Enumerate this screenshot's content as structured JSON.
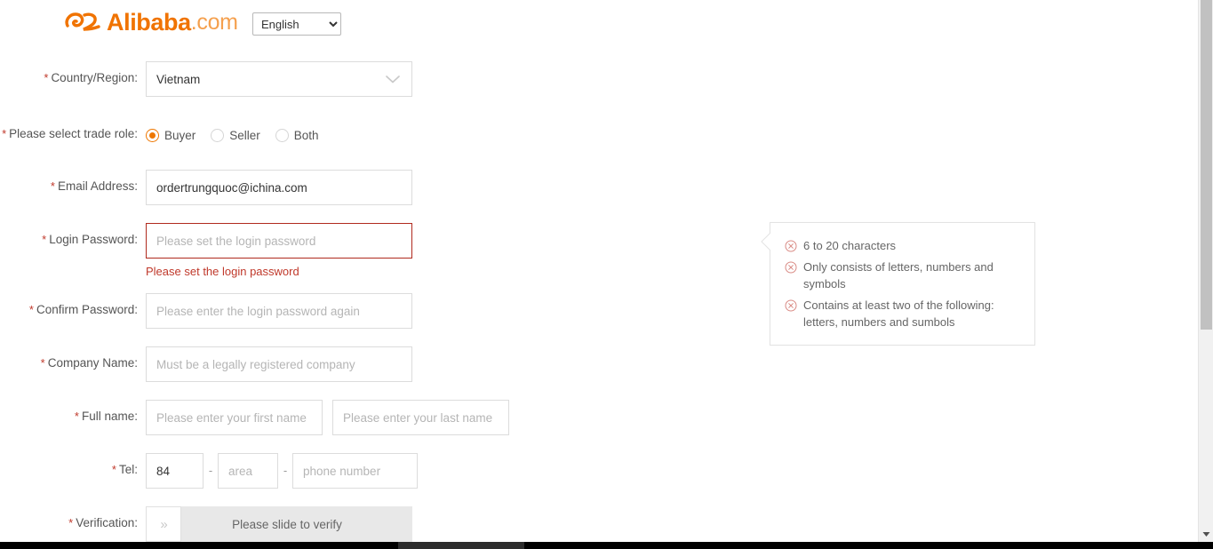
{
  "header": {
    "logo_text": "Alibaba",
    "logo_suffix": ".com",
    "logo_color": "#f07300",
    "logo_suffix_color": "#f5a04e",
    "language_selected": "English",
    "language_options": [
      "English"
    ]
  },
  "form": {
    "country": {
      "label": "Country/Region:",
      "required_mark": "*",
      "value": "Vietnam"
    },
    "trade_role": {
      "label": "Please select trade role:",
      "required_mark": "*",
      "options": [
        {
          "label": "Buyer",
          "selected": true
        },
        {
          "label": "Seller",
          "selected": false
        },
        {
          "label": "Both",
          "selected": false
        }
      ]
    },
    "email": {
      "label": "Email Address:",
      "required_mark": "*",
      "value": "ordertrungquoc@ichina.com",
      "placeholder": ""
    },
    "login_password": {
      "label": "Login Password:",
      "required_mark": "*",
      "value": "",
      "placeholder": "Please set the login password",
      "error_message": "Please set the login password",
      "error_color": "#c0392b",
      "border_color": "#b02a1e"
    },
    "confirm_password": {
      "label": "Confirm Password:",
      "required_mark": "*",
      "value": "",
      "placeholder": "Please enter the login password again"
    },
    "company_name": {
      "label": "Company Name:",
      "required_mark": "*",
      "value": "",
      "placeholder": "Must be a legally registered company"
    },
    "full_name": {
      "label": "Full name:",
      "required_mark": "*",
      "first_placeholder": "Please enter your first name",
      "last_placeholder": "Please enter your last name",
      "first_value": "",
      "last_value": ""
    },
    "tel": {
      "label": "Tel:",
      "required_mark": "*",
      "country_code": "84",
      "area_placeholder": "area",
      "area_value": "",
      "phone_placeholder": "phone number",
      "phone_value": "",
      "separator": "-"
    },
    "verification": {
      "label": "Verification:",
      "required_mark": "*",
      "slider_text": "Please slide to verify",
      "handle_icon": "double-chevron-right"
    }
  },
  "password_tip": {
    "icon": "circle-x-icon",
    "icon_color": "#d98b85",
    "rules": [
      "6 to 20 characters",
      "Only consists of letters, numbers and symbols",
      "Contains at least two of the following: letters, numbers and sumbols"
    ]
  },
  "scrollbar": {
    "thumb_color": "#c1c1c1",
    "track_color": "#f1f1f1",
    "down_arrow_icon": "triangle-down-icon"
  }
}
